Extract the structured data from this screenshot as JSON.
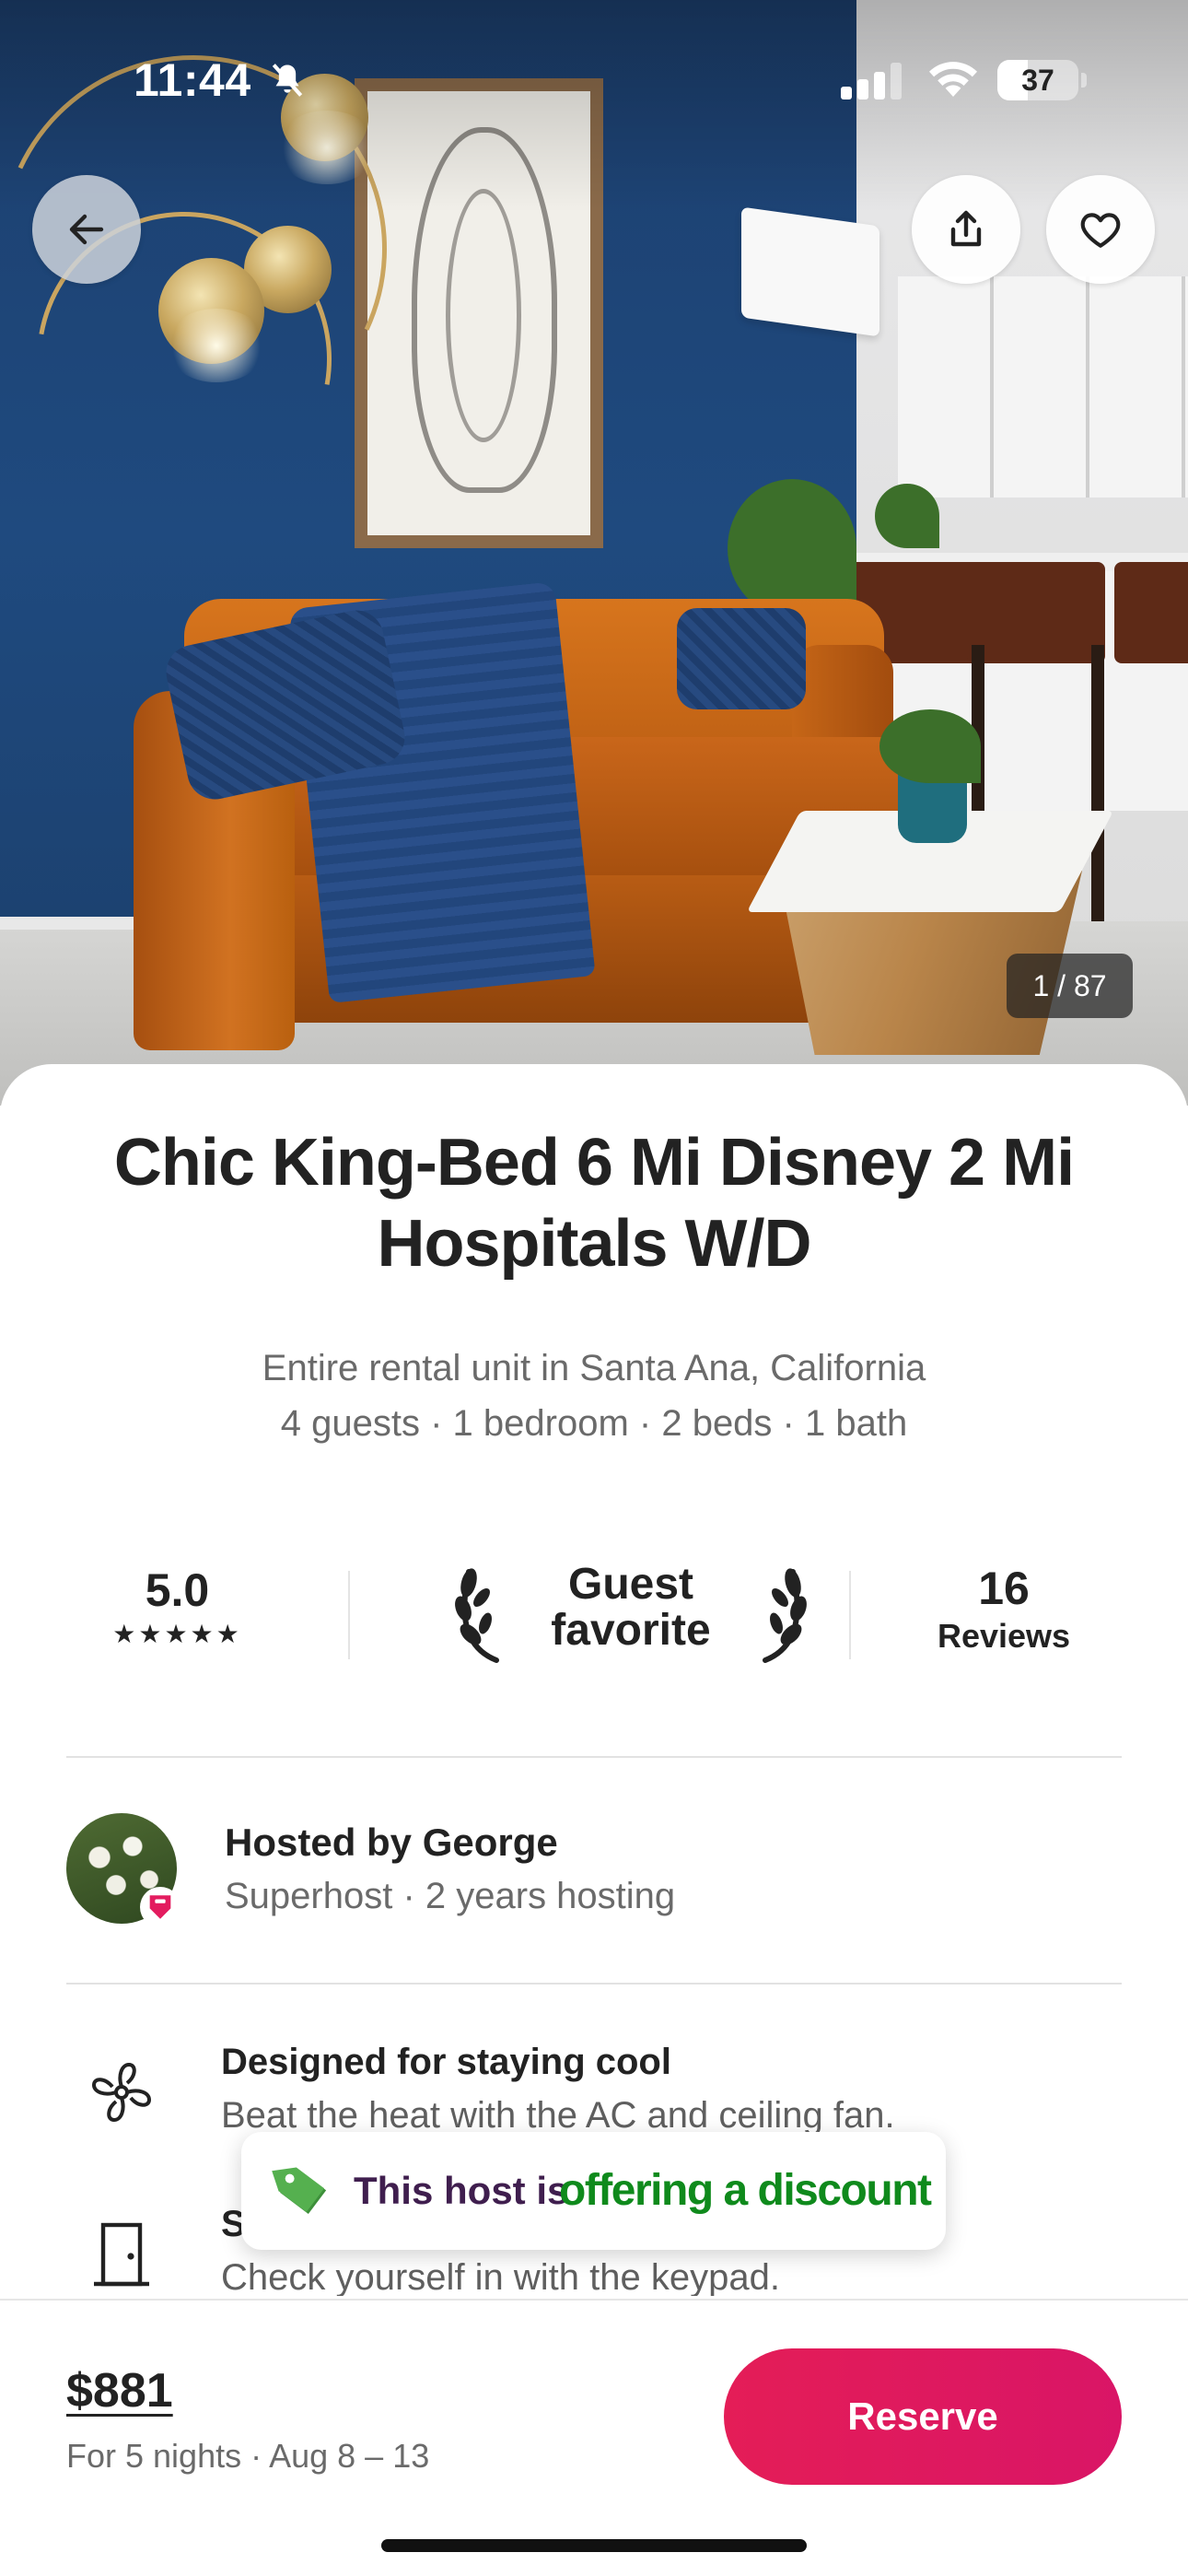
{
  "status_bar": {
    "time": "11:44",
    "battery_level": "37",
    "battery_fraction": 0.37
  },
  "photo": {
    "counter": "1 / 87"
  },
  "listing": {
    "title": "Chic King-Bed 6 Mi Disney 2 Mi Hospitals W/D",
    "subtitle_line1": "Entire rental unit in Santa Ana, California",
    "subtitle_line2": "4 guests · 1 bedroom · 2 beds · 1 bath"
  },
  "stats": {
    "rating": "5.0",
    "stars": "★★★★★",
    "badge_line1": "Guest",
    "badge_line2": "favorite",
    "reviews_count": "16",
    "reviews_label": "Reviews"
  },
  "host": {
    "name": "Hosted by George",
    "details": "Superhost · 2 years hosting"
  },
  "features": [
    {
      "icon": "fan-icon",
      "title": "Designed for staying cool",
      "description": "Beat the heat with the AC and ceiling fan."
    },
    {
      "icon": "door-icon",
      "title": "S",
      "description": "Check yourself in with the keypad."
    }
  ],
  "toast": {
    "prefix": "This host is",
    "highlight": "offering a discount",
    "icon": "tag-icon"
  },
  "footer": {
    "price": "$881",
    "price_details": "For 5 nights · Aug 8 – 13",
    "reserve_label": "Reserve"
  },
  "colors": {
    "brand": "#E31C5F",
    "discount_green": "#0F8A1C",
    "text_primary": "#222222",
    "text_secondary": "#6A6A6A"
  }
}
